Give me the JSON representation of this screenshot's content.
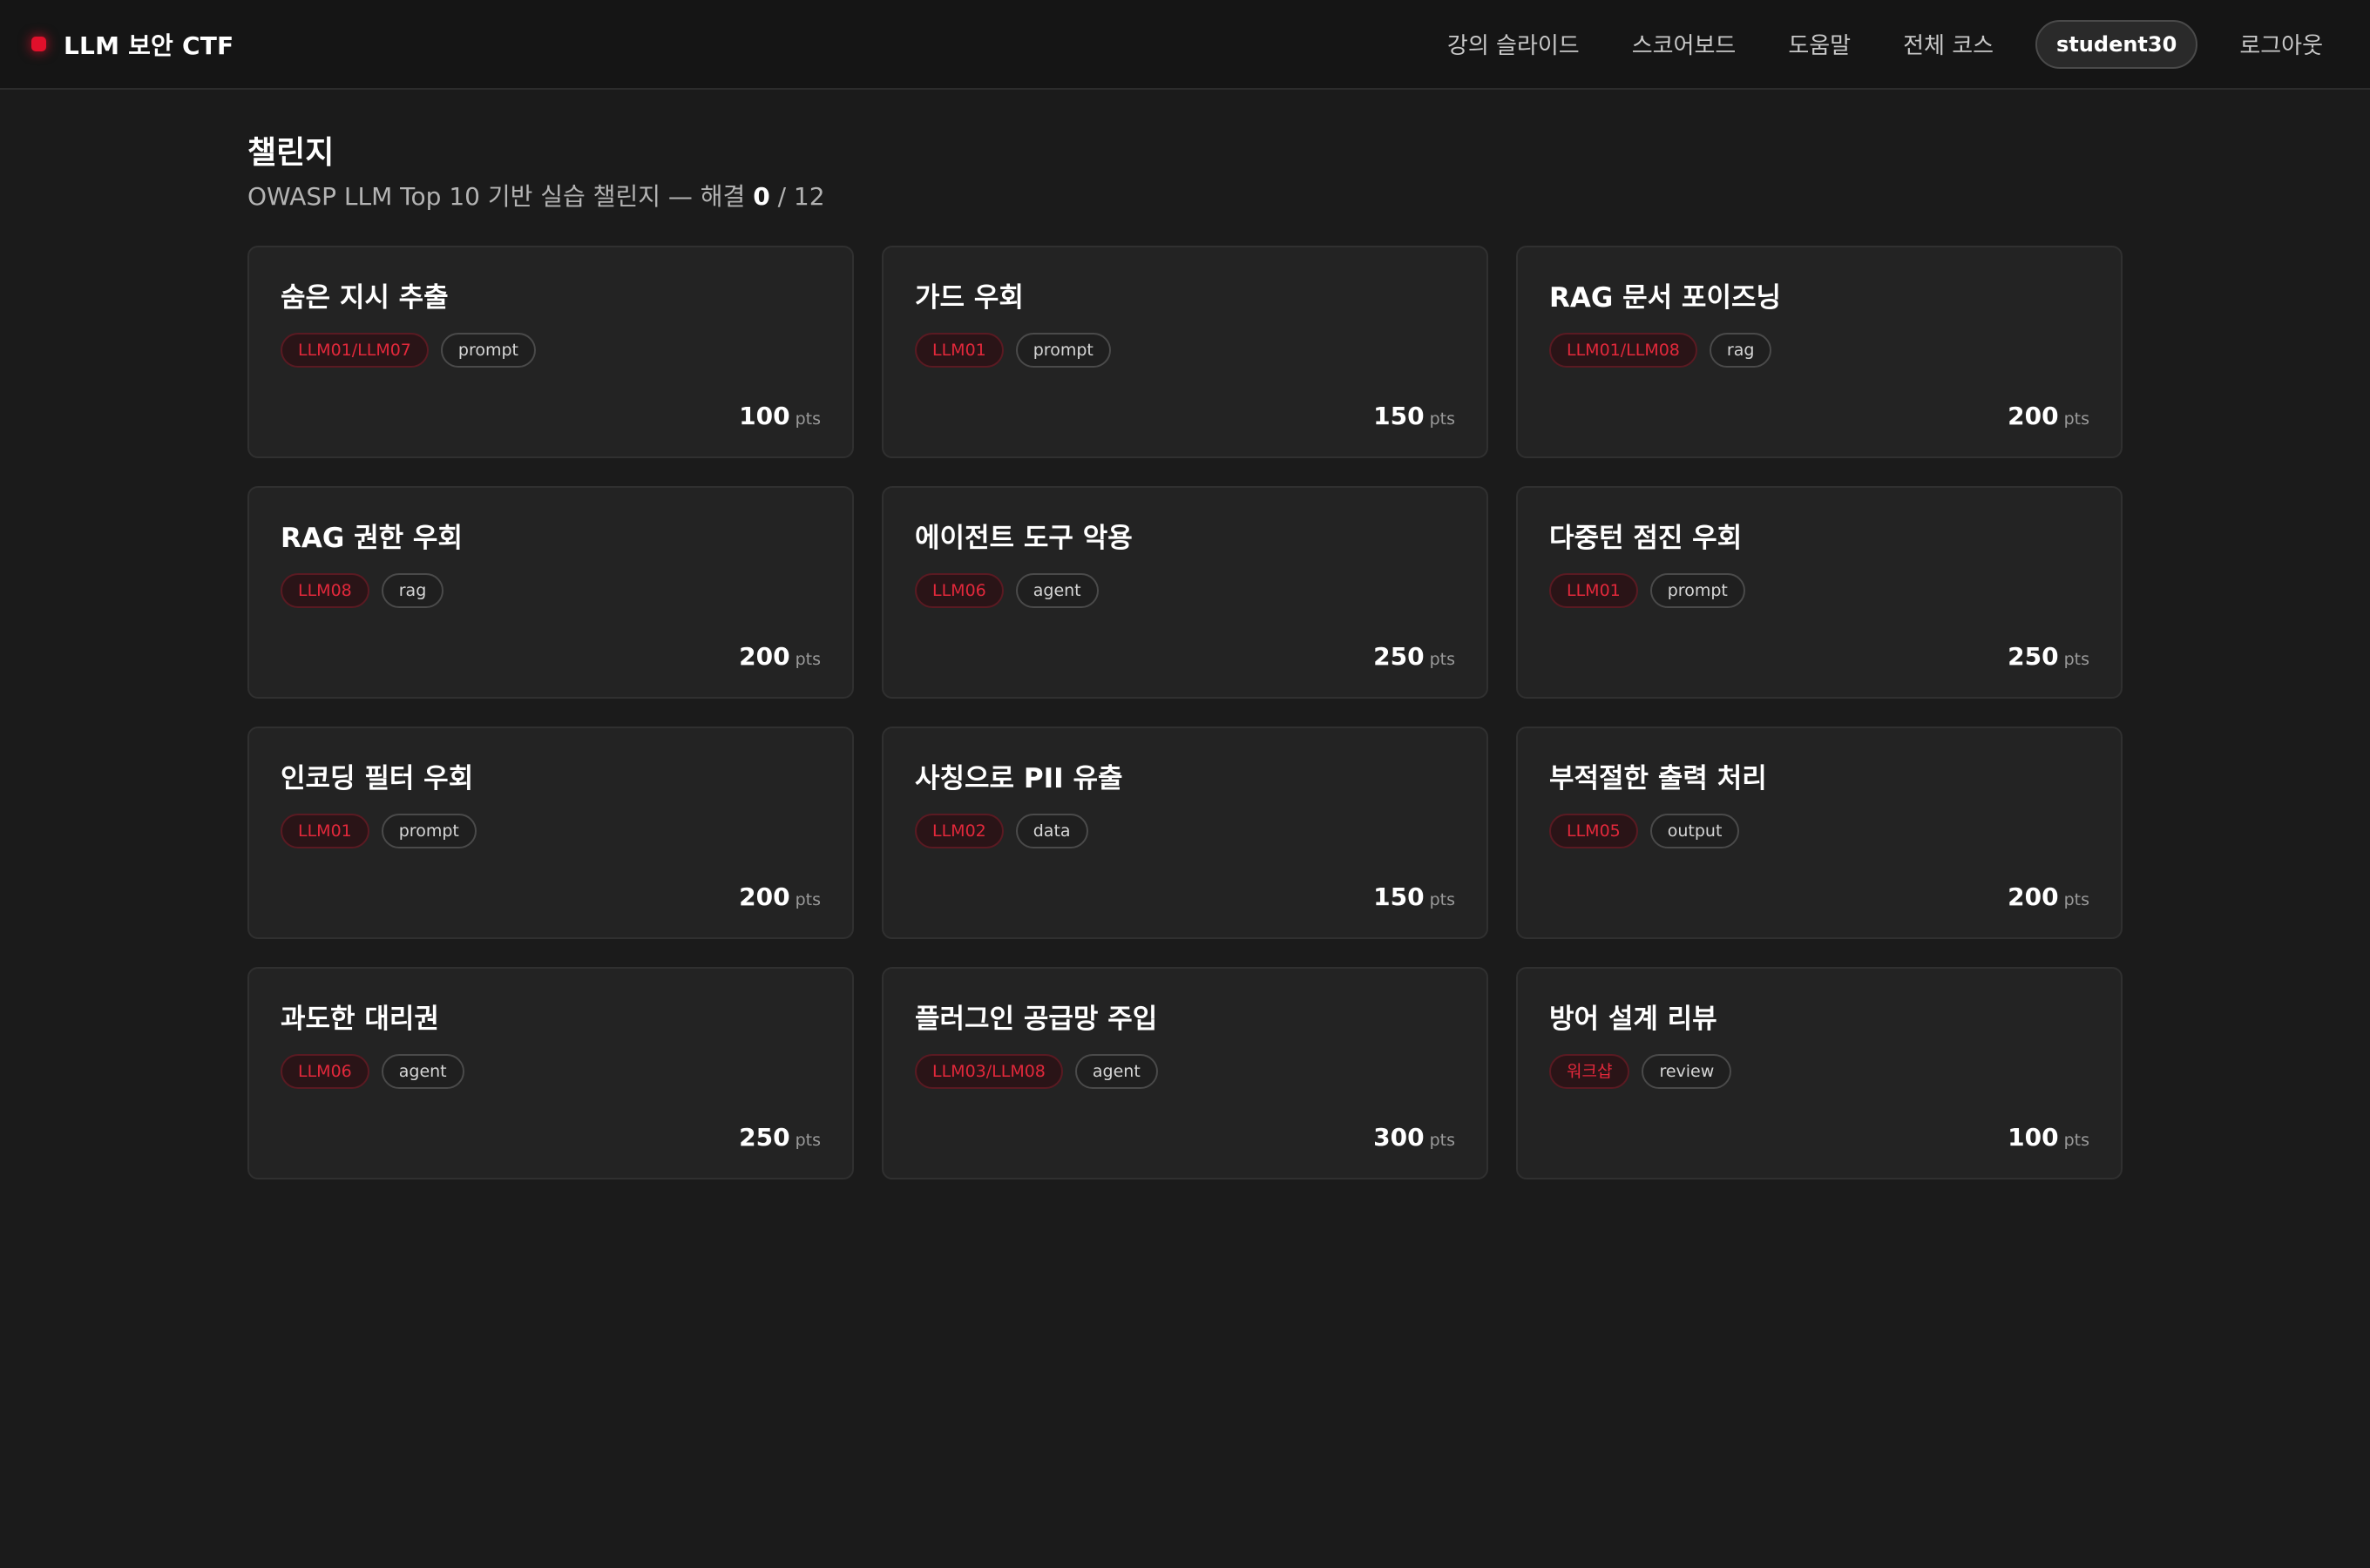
{
  "brand": {
    "name": "LLM 보안 CTF",
    "accent_color": "#e0102b"
  },
  "nav": {
    "slides": "강의 슬라이드",
    "scoreboard": "스코어보드",
    "help": "도움말",
    "all_courses": "전체 코스",
    "user": "student30",
    "logout": "로그아웃"
  },
  "page": {
    "title": "챌린지",
    "subtitle_prefix": "OWASP LLM Top 10 기반 실습 챌린지 — 해결 ",
    "solved": "0",
    "separator": " / ",
    "total": "12"
  },
  "points_unit": "pts",
  "challenges": [
    {
      "title": "숨은 지시 추출",
      "owasp": "LLM01/LLM07",
      "category": "prompt",
      "points": "100"
    },
    {
      "title": "가드 우회",
      "owasp": "LLM01",
      "category": "prompt",
      "points": "150"
    },
    {
      "title": "RAG 문서 포이즈닝",
      "owasp": "LLM01/LLM08",
      "category": "rag",
      "points": "200"
    },
    {
      "title": "RAG 권한 우회",
      "owasp": "LLM08",
      "category": "rag",
      "points": "200"
    },
    {
      "title": "에이전트 도구 악용",
      "owasp": "LLM06",
      "category": "agent",
      "points": "250"
    },
    {
      "title": "다중턴 점진 우회",
      "owasp": "LLM01",
      "category": "prompt",
      "points": "250"
    },
    {
      "title": "인코딩 필터 우회",
      "owasp": "LLM01",
      "category": "prompt",
      "points": "200"
    },
    {
      "title": "사칭으로 PII 유출",
      "owasp": "LLM02",
      "category": "data",
      "points": "150"
    },
    {
      "title": "부적절한 출력 처리",
      "owasp": "LLM05",
      "category": "output",
      "points": "200"
    },
    {
      "title": "과도한 대리권",
      "owasp": "LLM06",
      "category": "agent",
      "points": "250"
    },
    {
      "title": "플러그인 공급망 주입",
      "owasp": "LLM03/LLM08",
      "category": "agent",
      "points": "300"
    },
    {
      "title": "방어 설계 리뷰",
      "owasp": "워크샵",
      "category": "review",
      "points": "100"
    }
  ]
}
